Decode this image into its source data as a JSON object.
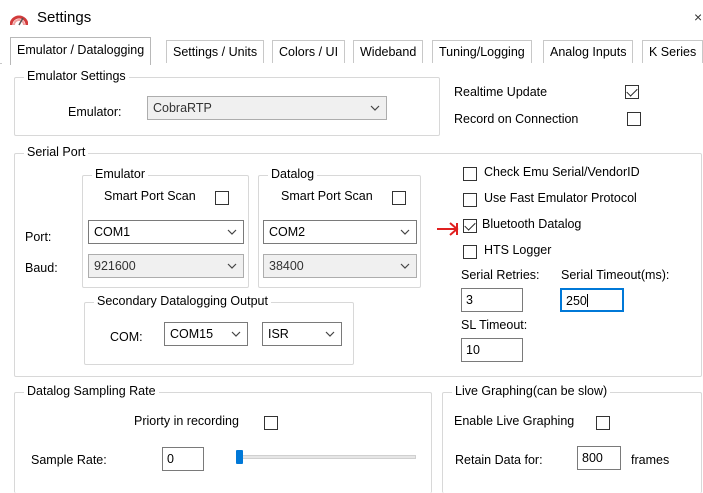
{
  "window": {
    "title": "Settings",
    "close_glyph": "×"
  },
  "tabs": [
    {
      "label": "Emulator / Datalogging",
      "active": true
    },
    {
      "label": "Settings / Units"
    },
    {
      "label": "Colors / UI"
    },
    {
      "label": "Wideband"
    },
    {
      "label": "Tuning/Logging"
    },
    {
      "label": "Analog Inputs"
    },
    {
      "label": "K Series"
    }
  ],
  "emulator_settings": {
    "title": "Emulator Settings",
    "emulator_label": "Emulator:",
    "emulator_value": "CobraRTP",
    "realtime_update_label": "Realtime Update",
    "realtime_update_checked": true,
    "record_on_connection_label": "Record on Connection",
    "record_on_connection_checked": false
  },
  "serial_port": {
    "title": "Serial Port",
    "emulator_group": {
      "title": "Emulator",
      "smart_port_scan_label": "Smart Port Scan",
      "smart_port_scan_checked": false,
      "port_value": "COM1",
      "baud_value": "921600"
    },
    "datalog_group": {
      "title": "Datalog",
      "smart_port_scan_label": "Smart Port Scan",
      "smart_port_scan_checked": false,
      "port_value": "COM2",
      "baud_value": "38400"
    },
    "port_label": "Port:",
    "baud_label": "Baud:",
    "secondary": {
      "title": "Secondary Datalogging Output",
      "com_label": "COM:",
      "com_value": "COM15",
      "mode_value": "ISR"
    },
    "options": [
      {
        "label": "Check Emu Serial/VendorID",
        "checked": false
      },
      {
        "label": "Use Fast Emulator Protocol",
        "checked": false
      },
      {
        "label": "Bluetooth Datalog",
        "checked": true
      },
      {
        "label": "HTS Logger",
        "checked": false
      }
    ],
    "serial_retries_label": "Serial Retries:",
    "serial_retries_value": "3",
    "serial_timeout_label": "Serial Timeout(ms):",
    "serial_timeout_value": "250",
    "sl_timeout_label": "SL Timeout:",
    "sl_timeout_value": "10"
  },
  "datalog_sampling": {
    "title": "Datalog Sampling Rate",
    "priority_label": "Priorty in recording",
    "priority_checked": false,
    "sample_rate_label": "Sample Rate:",
    "sample_rate_value": "0",
    "slider_position": 0
  },
  "live_graphing": {
    "title": "Live Graphing(can be slow)",
    "enable_label": "Enable Live Graphing",
    "enable_checked": false,
    "retain_label": "Retain Data for:",
    "retain_value": "800",
    "retain_unit": "frames"
  },
  "colors": {
    "accent": "#0078d7",
    "annotation_arrow": "#e02020"
  },
  "icons": {
    "window": "settings-app-icon",
    "dropdown": "chevron-down-icon",
    "annotation": "red-arrow-icon"
  }
}
